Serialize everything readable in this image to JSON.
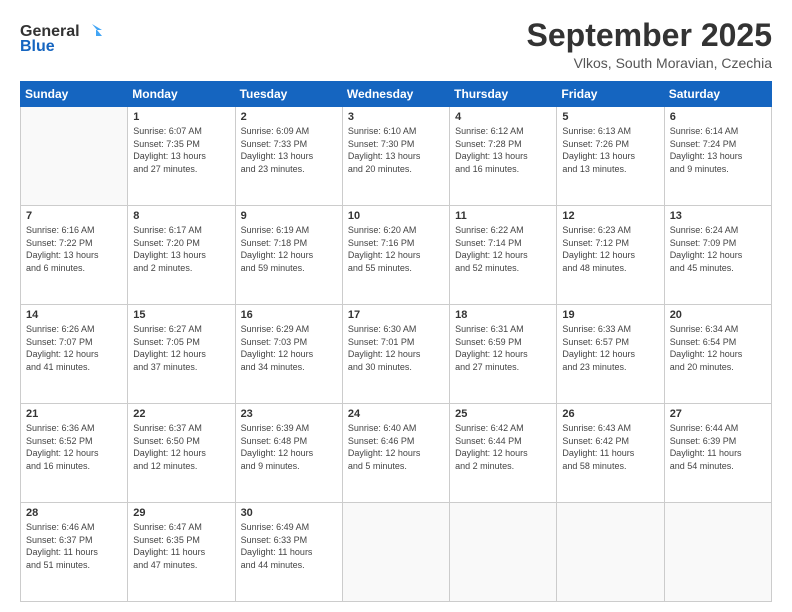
{
  "logo": {
    "line1": "General",
    "line2": "Blue"
  },
  "title": "September 2025",
  "subtitle": "Vlkos, South Moravian, Czechia",
  "header_days": [
    "Sunday",
    "Monday",
    "Tuesday",
    "Wednesday",
    "Thursday",
    "Friday",
    "Saturday"
  ],
  "weeks": [
    [
      {
        "day": "",
        "info": ""
      },
      {
        "day": "1",
        "info": "Sunrise: 6:07 AM\nSunset: 7:35 PM\nDaylight: 13 hours\nand 27 minutes."
      },
      {
        "day": "2",
        "info": "Sunrise: 6:09 AM\nSunset: 7:33 PM\nDaylight: 13 hours\nand 23 minutes."
      },
      {
        "day": "3",
        "info": "Sunrise: 6:10 AM\nSunset: 7:30 PM\nDaylight: 13 hours\nand 20 minutes."
      },
      {
        "day": "4",
        "info": "Sunrise: 6:12 AM\nSunset: 7:28 PM\nDaylight: 13 hours\nand 16 minutes."
      },
      {
        "day": "5",
        "info": "Sunrise: 6:13 AM\nSunset: 7:26 PM\nDaylight: 13 hours\nand 13 minutes."
      },
      {
        "day": "6",
        "info": "Sunrise: 6:14 AM\nSunset: 7:24 PM\nDaylight: 13 hours\nand 9 minutes."
      }
    ],
    [
      {
        "day": "7",
        "info": "Sunrise: 6:16 AM\nSunset: 7:22 PM\nDaylight: 13 hours\nand 6 minutes."
      },
      {
        "day": "8",
        "info": "Sunrise: 6:17 AM\nSunset: 7:20 PM\nDaylight: 13 hours\nand 2 minutes."
      },
      {
        "day": "9",
        "info": "Sunrise: 6:19 AM\nSunset: 7:18 PM\nDaylight: 12 hours\nand 59 minutes."
      },
      {
        "day": "10",
        "info": "Sunrise: 6:20 AM\nSunset: 7:16 PM\nDaylight: 12 hours\nand 55 minutes."
      },
      {
        "day": "11",
        "info": "Sunrise: 6:22 AM\nSunset: 7:14 PM\nDaylight: 12 hours\nand 52 minutes."
      },
      {
        "day": "12",
        "info": "Sunrise: 6:23 AM\nSunset: 7:12 PM\nDaylight: 12 hours\nand 48 minutes."
      },
      {
        "day": "13",
        "info": "Sunrise: 6:24 AM\nSunset: 7:09 PM\nDaylight: 12 hours\nand 45 minutes."
      }
    ],
    [
      {
        "day": "14",
        "info": "Sunrise: 6:26 AM\nSunset: 7:07 PM\nDaylight: 12 hours\nand 41 minutes."
      },
      {
        "day": "15",
        "info": "Sunrise: 6:27 AM\nSunset: 7:05 PM\nDaylight: 12 hours\nand 37 minutes."
      },
      {
        "day": "16",
        "info": "Sunrise: 6:29 AM\nSunset: 7:03 PM\nDaylight: 12 hours\nand 34 minutes."
      },
      {
        "day": "17",
        "info": "Sunrise: 6:30 AM\nSunset: 7:01 PM\nDaylight: 12 hours\nand 30 minutes."
      },
      {
        "day": "18",
        "info": "Sunrise: 6:31 AM\nSunset: 6:59 PM\nDaylight: 12 hours\nand 27 minutes."
      },
      {
        "day": "19",
        "info": "Sunrise: 6:33 AM\nSunset: 6:57 PM\nDaylight: 12 hours\nand 23 minutes."
      },
      {
        "day": "20",
        "info": "Sunrise: 6:34 AM\nSunset: 6:54 PM\nDaylight: 12 hours\nand 20 minutes."
      }
    ],
    [
      {
        "day": "21",
        "info": "Sunrise: 6:36 AM\nSunset: 6:52 PM\nDaylight: 12 hours\nand 16 minutes."
      },
      {
        "day": "22",
        "info": "Sunrise: 6:37 AM\nSunset: 6:50 PM\nDaylight: 12 hours\nand 12 minutes."
      },
      {
        "day": "23",
        "info": "Sunrise: 6:39 AM\nSunset: 6:48 PM\nDaylight: 12 hours\nand 9 minutes."
      },
      {
        "day": "24",
        "info": "Sunrise: 6:40 AM\nSunset: 6:46 PM\nDaylight: 12 hours\nand 5 minutes."
      },
      {
        "day": "25",
        "info": "Sunrise: 6:42 AM\nSunset: 6:44 PM\nDaylight: 12 hours\nand 2 minutes."
      },
      {
        "day": "26",
        "info": "Sunrise: 6:43 AM\nSunset: 6:42 PM\nDaylight: 11 hours\nand 58 minutes."
      },
      {
        "day": "27",
        "info": "Sunrise: 6:44 AM\nSunset: 6:39 PM\nDaylight: 11 hours\nand 54 minutes."
      }
    ],
    [
      {
        "day": "28",
        "info": "Sunrise: 6:46 AM\nSunset: 6:37 PM\nDaylight: 11 hours\nand 51 minutes."
      },
      {
        "day": "29",
        "info": "Sunrise: 6:47 AM\nSunset: 6:35 PM\nDaylight: 11 hours\nand 47 minutes."
      },
      {
        "day": "30",
        "info": "Sunrise: 6:49 AM\nSunset: 6:33 PM\nDaylight: 11 hours\nand 44 minutes."
      },
      {
        "day": "",
        "info": ""
      },
      {
        "day": "",
        "info": ""
      },
      {
        "day": "",
        "info": ""
      },
      {
        "day": "",
        "info": ""
      }
    ]
  ]
}
